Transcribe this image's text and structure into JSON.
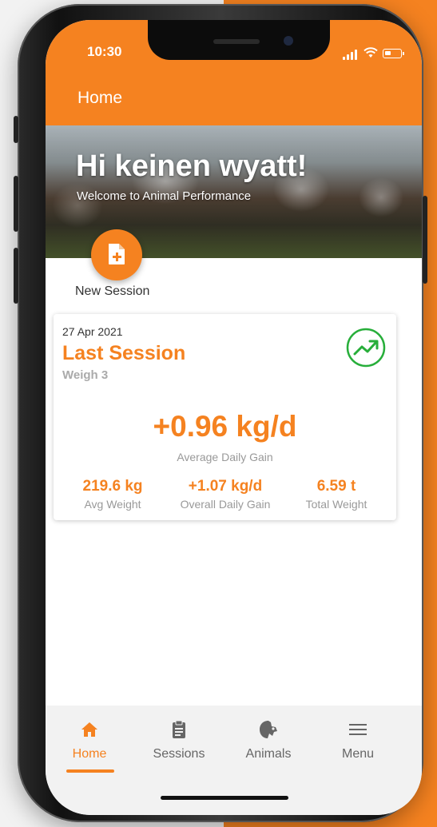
{
  "colors": {
    "accent": "#f58220",
    "trend": "#27ae3a",
    "background_right": "#f58220"
  },
  "status_bar": {
    "time": "10:30"
  },
  "header": {
    "title": "Home"
  },
  "hero": {
    "greeting": "Hi keinen wyatt!",
    "subtitle": "Welcome to Animal Performance"
  },
  "new_session": {
    "label": "New Session",
    "icon": "add-file-icon"
  },
  "last_session": {
    "date": "27 Apr 2021",
    "title": "Last Session",
    "subtitle": "Weigh 3",
    "trend_icon": "trending-up-icon",
    "main_value": "+0.96 kg/d",
    "main_label": "Average Daily Gain",
    "stats": [
      {
        "value": "219.6 kg",
        "label": "Avg Weight"
      },
      {
        "value": "+1.07 kg/d",
        "label": "Overall Daily Gain"
      },
      {
        "value": "6.59 t",
        "label": "Total Weight"
      }
    ]
  },
  "tabs": [
    {
      "label": "Home",
      "icon": "home-icon",
      "active": true
    },
    {
      "label": "Sessions",
      "icon": "clipboard-icon",
      "active": false
    },
    {
      "label": "Animals",
      "icon": "animal-icon",
      "active": false
    },
    {
      "label": "Menu",
      "icon": "menu-icon",
      "active": false
    }
  ]
}
